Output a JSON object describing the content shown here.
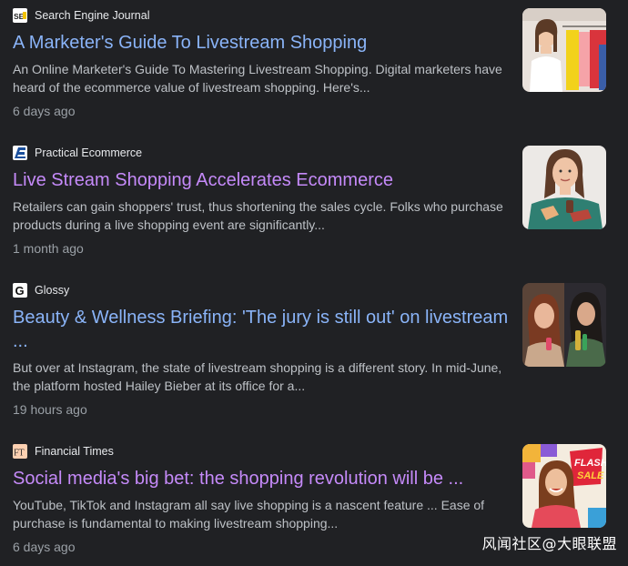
{
  "results": [
    {
      "source": "Search Engine Journal",
      "source_icon": "sej-logo-icon",
      "title": "A Marketer's Guide To Livestream Shopping",
      "snippet": "An Online Marketer's Guide To Mastering Livestream Shopping. Digital marketers have heard of the ecommerce value of livestream shopping. Here's...",
      "age": "6 days ago",
      "visited": false,
      "thumbnail": "woman-with-clothing-rack-thumbnail"
    },
    {
      "source": "Practical Ecommerce",
      "source_icon": "practical-ecommerce-logo-icon",
      "title": "Live Stream Shopping Accelerates Ecommerce",
      "snippet": "Retailers can gain shoppers' trust, thus shortening the sales cycle. Folks who purchase products during a live shopping event are significantly...",
      "age": "1 month ago",
      "visited": true,
      "thumbnail": "woman-holding-product-thumbnail"
    },
    {
      "source": "Glossy",
      "source_icon": "glossy-logo-icon",
      "title": "Beauty & Wellness Briefing: 'The jury is still out' on livestream ...",
      "snippet": "But over at Instagram, the state of livestream shopping is a different story. In mid-June, the platform hosted Hailey Bieber at its office for a...",
      "age": "19 hours ago",
      "visited": false,
      "thumbnail": "two-women-livestream-thumbnail"
    },
    {
      "source": "Financial Times",
      "source_icon": "ft-logo-icon",
      "title": "Social media's big bet: the shopping revolution will be ...",
      "snippet": "YouTube, TikTok and Instagram all say live shopping is a nascent feature ... Ease of purchase is fundamental to making livestream shopping...",
      "age": "6 days ago",
      "visited": true,
      "thumbnail": "flash-sale-woman-thumbnail"
    }
  ],
  "watermark": "风闻社区@大眼联盟",
  "colors": {
    "background": "#202124",
    "link": "#8ab4f8",
    "visited_link": "#c58af9",
    "snippet": "#bdc1c6",
    "meta": "#9aa0a6"
  }
}
